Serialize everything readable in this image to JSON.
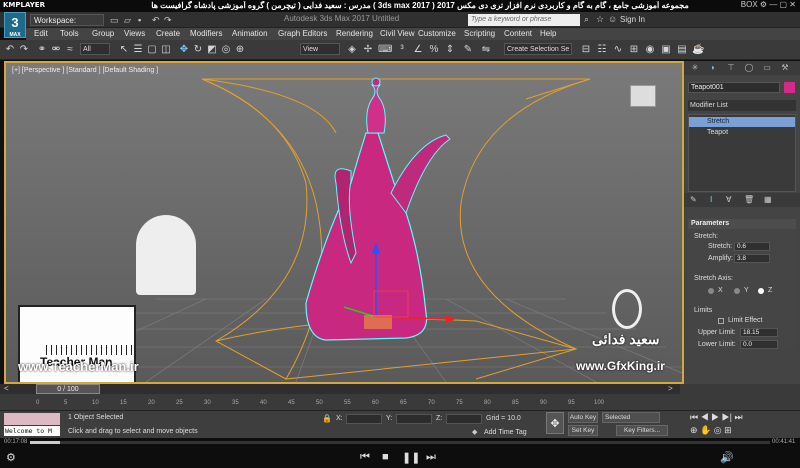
{
  "player": {
    "logo": "KMPLAYER",
    "title": "مجموعه آموزشی جامع ، گام به گام و کاربردی نرم افزار تری دی مکس 2017 ( 3ds max 2017 ) مدرس : سعید فدایی ( تیچرمن ) گروه آموزشی پادشاه گرافیست ها",
    "controls": "BOX ⚙ — ▢ ✕",
    "time_current": "00:17:08",
    "time_total": "00:41:41",
    "progress_fraction": 0.04
  },
  "max": {
    "logo": "3",
    "logo_sub": "MAX",
    "workspace": "Workspace: Default",
    "app_title": "Autodesk 3ds Max 2017    Untitled",
    "search_placeholder": "Type a keyword or phrase",
    "signin": "Sign In"
  },
  "menu": [
    "Edit",
    "Tools",
    "Group",
    "Views",
    "Create",
    "Modifiers",
    "Animation",
    "Graph Editors",
    "Rendering",
    "Civil View",
    "Customize",
    "Scripting",
    "Content",
    "Help"
  ],
  "toolbar": {
    "filter": "All",
    "refcoord": "View",
    "selection_set": "Create Selection Se"
  },
  "viewport": {
    "label": "[+] [Perspective ] [Standard ] [Default Shading ]"
  },
  "panel": {
    "object_name": "Teapot001",
    "object_color": "#d42a8a",
    "modifier_list": "Modifier List",
    "stack": [
      "Stretch",
      "Teapot"
    ],
    "parameters_title": "Parameters",
    "stretch_group": "Stretch:",
    "stretch_label": "Stretch:",
    "stretch_value": "0.6",
    "amplify_label": "Amplify:",
    "amplify_value": "3.8",
    "axis_group": "Stretch Axis:",
    "axes": [
      "X",
      "Y",
      "Z"
    ],
    "selected_axis": "Z",
    "limits_group": "Limits",
    "limit_effect": "Limit Effect",
    "upper_label": "Upper Limit:",
    "upper_value": "18.15",
    "lower_label": "Lower Limit:",
    "lower_value": "0.0"
  },
  "timeline": {
    "frame_display": "0 / 100",
    "ticks": [
      "0",
      "5",
      "10",
      "15",
      "20",
      "25",
      "30",
      "35",
      "40",
      "45",
      "50",
      "55",
      "60",
      "65",
      "70",
      "75",
      "80",
      "85",
      "90",
      "95",
      "100"
    ]
  },
  "status": {
    "welcome": "Welcome to M",
    "selected": "1 Object Selected",
    "prompt": "Click and drag to select and move objects",
    "x_label": "X:",
    "y_label": "Y:",
    "z_label": "Z:",
    "grid": "Grid = 10.0",
    "add_time_tag": "Add Time Tag",
    "auto_key": "Auto Key",
    "set_key": "Set Key",
    "selected_dd": "Selected",
    "key_filters": "Key Filters..."
  },
  "overlays": {
    "teacher_name": "Teacher Man",
    "teacher_url": "www.TeacherMan.ir",
    "gfx_name": "سعید فدائی",
    "gfx_url": "www.GfxKing.ir"
  }
}
